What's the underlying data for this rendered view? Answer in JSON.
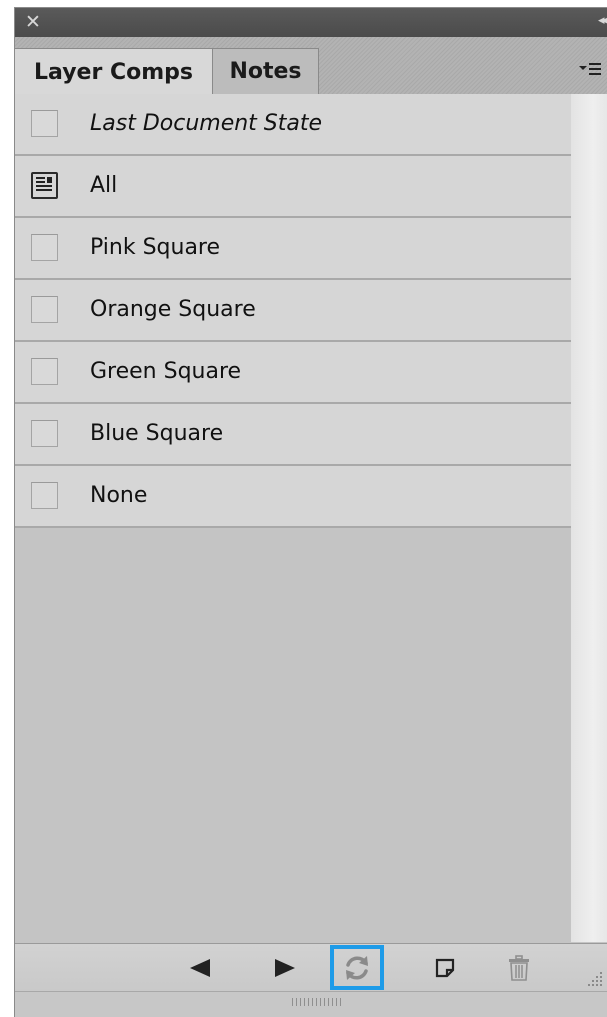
{
  "window": {
    "close_glyph": "✕",
    "collapse_glyph": "◂◂"
  },
  "tabs": [
    {
      "label": "Layer Comps",
      "active": true
    },
    {
      "label": "Notes",
      "active": false
    }
  ],
  "comps": [
    {
      "label": "Last Document State",
      "italic": true,
      "applied": false
    },
    {
      "label": "All",
      "italic": false,
      "applied": true
    },
    {
      "label": "Pink Square",
      "italic": false,
      "applied": false
    },
    {
      "label": "Orange Square",
      "italic": false,
      "applied": false
    },
    {
      "label": "Green Square",
      "italic": false,
      "applied": false
    },
    {
      "label": "Blue Square",
      "italic": false,
      "applied": false
    },
    {
      "label": "None",
      "italic": false,
      "applied": false
    }
  ],
  "toolbar": {
    "highlight_color": "#1e9be8",
    "buttons": [
      "previous-comp",
      "next-comp",
      "update-comp",
      "new-comp",
      "delete-comp"
    ]
  }
}
